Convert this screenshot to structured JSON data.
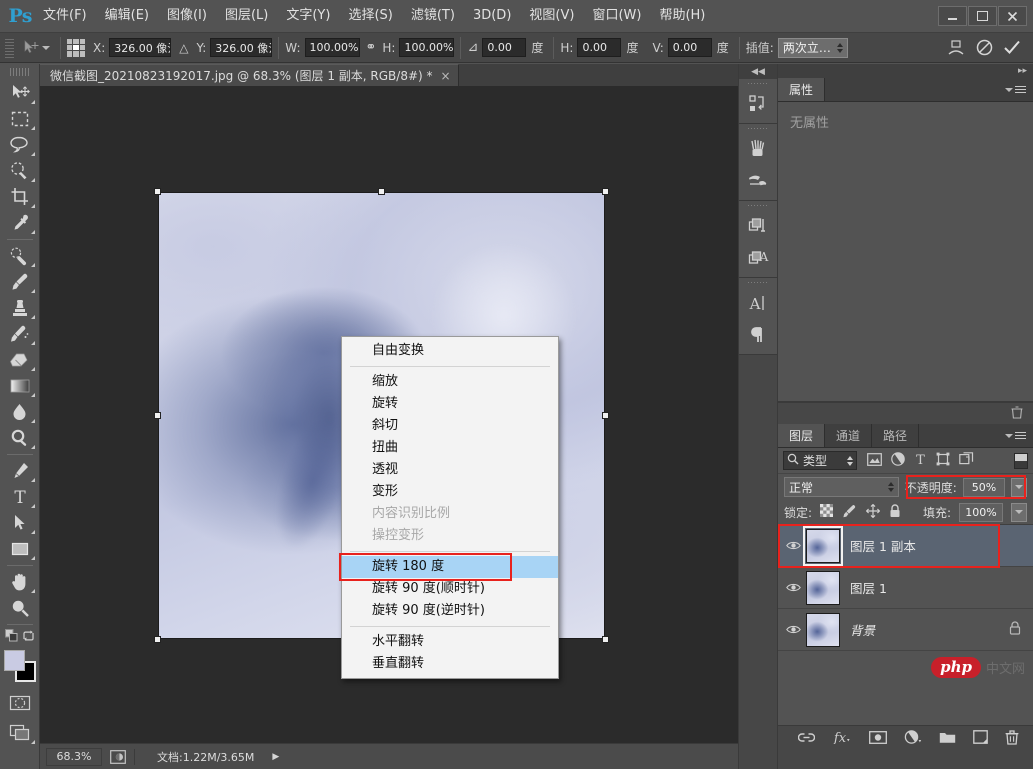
{
  "app": {
    "logo": "Ps",
    "menu": [
      "文件(F)",
      "编辑(E)",
      "图像(I)",
      "图层(L)",
      "文字(Y)",
      "选择(S)",
      "滤镜(T)",
      "3D(D)",
      "视图(V)",
      "窗口(W)",
      "帮助(H)"
    ],
    "window_controls": {
      "minimize": "—",
      "maximize": "□",
      "close": "✕"
    }
  },
  "options_bar": {
    "x_label": "X:",
    "x_value": "326.00 像氵",
    "delta_icon": "△",
    "y_label": "Y:",
    "y_value": "326.00 像氵",
    "w_label": "W:",
    "w_value": "100.00%",
    "link_icon": "⚭",
    "h_label": "H:",
    "h_value": "100.00%",
    "angle_icon": "⊿",
    "angle_value": "0.00",
    "angle_unit": "度",
    "skew_h_label": "H:",
    "skew_h_value": "0.00",
    "skew_h_unit": "度",
    "skew_v_label": "V:",
    "skew_v_value": "0.00",
    "skew_v_unit": "度",
    "interp_label": "插值:",
    "interp_value": "两次立…",
    "warp_icon": "warp-mode-icon",
    "cancel_icon": "⊘",
    "commit_icon": "✓"
  },
  "document_tab": {
    "title": "微信截图_20210823192017.jpg @ 68.3% (图层 1 副本, RGB/8#) *",
    "close": "×"
  },
  "toolbar": {
    "tools": [
      {
        "name": "move-tool",
        "has_submenu": true
      },
      {
        "name": "rectangular-marquee-tool",
        "has_submenu": true
      },
      {
        "name": "lasso-tool",
        "has_submenu": true
      },
      {
        "name": "quick-selection-tool",
        "has_submenu": true
      },
      {
        "name": "crop-tool",
        "has_submenu": true
      },
      {
        "name": "eyedropper-tool",
        "has_submenu": true
      },
      {
        "name": "spot-healing-brush-tool",
        "has_submenu": true
      },
      {
        "name": "brush-tool",
        "has_submenu": true
      },
      {
        "name": "clone-stamp-tool",
        "has_submenu": true
      },
      {
        "name": "history-brush-tool",
        "has_submenu": true
      },
      {
        "name": "eraser-tool",
        "has_submenu": true
      },
      {
        "name": "gradient-tool",
        "has_submenu": true
      },
      {
        "name": "blur-tool",
        "has_submenu": true
      },
      {
        "name": "dodge-tool",
        "has_submenu": true
      },
      {
        "name": "pen-tool",
        "has_submenu": true
      },
      {
        "name": "horizontal-type-tool",
        "has_submenu": true
      },
      {
        "name": "path-selection-tool",
        "has_submenu": true
      },
      {
        "name": "rectangle-tool",
        "has_submenu": true
      },
      {
        "name": "hand-tool",
        "has_submenu": true
      },
      {
        "name": "zoom-tool",
        "has_submenu": false
      }
    ],
    "default_colors_icon": "default-colors-icon",
    "swap_colors_icon": "swap-colors-icon",
    "foreground_color": "#c9cbe3",
    "background_color": "#000000",
    "quick_mask_icon": "quick-mask-icon",
    "screen_mode_icon": "screen-mode-icon"
  },
  "context_menu": {
    "items": [
      {
        "label": "自由变换",
        "state": "normal"
      },
      {
        "label": "__separator__",
        "state": "separator"
      },
      {
        "label": "缩放",
        "state": "normal"
      },
      {
        "label": "旋转",
        "state": "normal"
      },
      {
        "label": "斜切",
        "state": "normal"
      },
      {
        "label": "扭曲",
        "state": "normal"
      },
      {
        "label": "透视",
        "state": "normal"
      },
      {
        "label": "变形",
        "state": "normal"
      },
      {
        "label": "内容识别比例",
        "state": "disabled"
      },
      {
        "label": "操控变形",
        "state": "disabled"
      },
      {
        "label": "__separator__",
        "state": "separator"
      },
      {
        "label": "旋转 180 度",
        "state": "selected"
      },
      {
        "label": "旋转 90 度(顺时针)",
        "state": "normal"
      },
      {
        "label": "旋转 90 度(逆时针)",
        "state": "normal"
      },
      {
        "label": "__separator__",
        "state": "separator"
      },
      {
        "label": "水平翻转",
        "state": "normal"
      },
      {
        "label": "垂直翻转",
        "state": "normal"
      }
    ],
    "highlight_color": "#a8d4f5",
    "annotation_color": "#e8221d"
  },
  "icon_strip": {
    "collapse_icon": "◀◀",
    "groups": [
      [
        "history-panel-icon"
      ],
      [
        "brush-presets-icon",
        "brush-panel-icon"
      ],
      [
        "layer-comps-icon",
        "character-styles-icon"
      ],
      [
        "character-panel-icon",
        "paragraph-panel-icon"
      ]
    ]
  },
  "properties_panel": {
    "collapse_icon": "▸▸",
    "tab_label": "属性",
    "empty_message": "无属性",
    "menu_icon": "panel-menu-icon"
  },
  "layers_panel": {
    "tabs": [
      {
        "label": "图层",
        "active": true
      },
      {
        "label": "通道",
        "active": false
      },
      {
        "label": "路径",
        "active": false
      }
    ],
    "menu_icon": "panel-menu-icon",
    "filter": {
      "search_icon": "search-icon",
      "kind_label": "类型",
      "icons": [
        "filter-pixel-icon",
        "filter-adjustment-icon",
        "filter-type-icon",
        "filter-shape-icon",
        "filter-smart-object-icon"
      ],
      "toggle_name": "filter-enable-toggle"
    },
    "blend": {
      "mode": "正常",
      "opacity_label": "不透明度:",
      "opacity_value": "50%"
    },
    "lock": {
      "label": "锁定:",
      "icons": [
        "lock-transparent-pixels-icon",
        "lock-image-pixels-icon",
        "lock-position-icon",
        "lock-all-icon"
      ],
      "fill_label": "填充:",
      "fill_value": "100%"
    },
    "layers": [
      {
        "name": "图层 1 副本",
        "visible": true,
        "active": true,
        "locked": false,
        "italic": false
      },
      {
        "name": "图层 1",
        "visible": true,
        "active": false,
        "locked": false,
        "italic": false
      },
      {
        "name": "背景",
        "visible": true,
        "active": false,
        "locked": true,
        "italic": true
      }
    ],
    "footer_icons": [
      "link-layers-icon",
      "layer-style-fx-icon",
      "add-layer-mask-icon",
      "new-adjustment-layer-icon",
      "new-group-icon",
      "new-layer-icon",
      "delete-layer-icon"
    ],
    "annotations": {
      "opacity_box_color": "#e8221d",
      "active_layer_box_color": "#e8221d"
    }
  },
  "watermark": {
    "brand": "php",
    "site": "中文网"
  },
  "status_bar": {
    "zoom": "68.3%",
    "doc_icon": "document-profile-icon",
    "doc_info": "文档:1.22M/3.65M",
    "expand_arrow": "▶"
  },
  "canvas": {
    "selection_handles": 8,
    "image_alt": "cloud-photo"
  }
}
